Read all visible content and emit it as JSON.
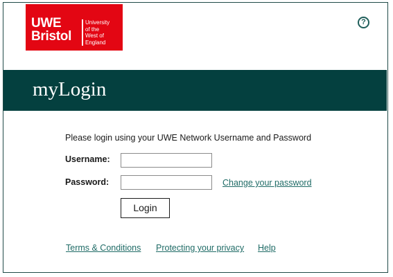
{
  "logo": {
    "line1": "UWE",
    "line2": "Bristol",
    "sub": [
      "University",
      "of the",
      "West of",
      "England"
    ],
    "color": "#e30613"
  },
  "help_icon": {
    "glyph": "?",
    "color": "#1f5e5a"
  },
  "banner": {
    "title": "myLogin",
    "color": "#04403f"
  },
  "form": {
    "intro": "Please login using your UWE Network Username and Password",
    "username_label": "Username:",
    "username_value": "",
    "password_label": "Password:",
    "password_value": "",
    "change_password_link": "Change your password",
    "login_button": "Login"
  },
  "footer": {
    "terms": "Terms & Conditions",
    "privacy": "Protecting your privacy",
    "help": "Help"
  },
  "colors": {
    "link": "#1f6b66",
    "border": "#1f4a47"
  }
}
